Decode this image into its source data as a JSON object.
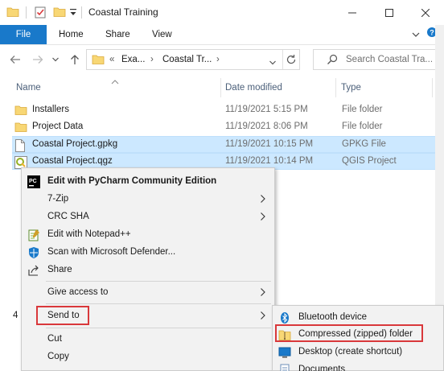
{
  "window": {
    "title": "Coastal Training",
    "controls": [
      "minimize-icon",
      "maximize-icon",
      "close-icon"
    ]
  },
  "ribbon": {
    "tabs": [
      {
        "label": "File",
        "active": true
      },
      {
        "label": "Home"
      },
      {
        "label": "Share"
      },
      {
        "label": "View"
      }
    ]
  },
  "address": {
    "overflow": "«",
    "crumbs": [
      "Exa...",
      "Coastal Tr..."
    ],
    "search_placeholder": "Search Coastal Tra..."
  },
  "columns": {
    "name": "Name",
    "date": "Date modified",
    "type": "Type",
    "size": "S"
  },
  "files": [
    {
      "name": "Installers",
      "date": "11/19/2021 5:15 PM",
      "type": "File folder",
      "icon": "folder-icon",
      "selected": false
    },
    {
      "name": "Project Data",
      "date": "11/19/2021 8:06 PM",
      "type": "File folder",
      "icon": "folder-icon",
      "selected": false
    },
    {
      "name": "Coastal Project.gpkg",
      "date": "11/19/2021 10:15 PM",
      "type": "GPKG File",
      "icon": "document-icon",
      "selected": true
    },
    {
      "name": "Coastal Project.qgz",
      "date": "11/19/2021 10:14 PM",
      "type": "QGIS Project",
      "icon": "qgis-icon",
      "selected": true
    }
  ],
  "status": {
    "item_count": "4"
  },
  "context_menu": {
    "items": [
      {
        "label": "Edit with PyCharm Community Edition",
        "icon": "pycharm-icon",
        "bold": true
      },
      {
        "label": "7-Zip",
        "submenu": true
      },
      {
        "label": "CRC SHA",
        "submenu": true
      },
      {
        "label": "Edit with Notepad++",
        "icon": "notepad-plus-plus-icon"
      },
      {
        "label": "Scan with Microsoft Defender...",
        "icon": "defender-shield-icon"
      },
      {
        "label": "Share",
        "icon": "share-icon"
      },
      {
        "label": "Give access to",
        "submenu": true
      },
      {
        "label": "Send to",
        "submenu": true,
        "highlighted": true
      },
      {
        "label": "Cut"
      },
      {
        "label": "Copy"
      }
    ]
  },
  "send_to_menu": {
    "items": [
      {
        "label": "Bluetooth device",
        "icon": "bluetooth-icon"
      },
      {
        "label": "Compressed (zipped) folder",
        "icon": "zip-folder-icon",
        "highlighted": true
      },
      {
        "label": "Desktop (create shortcut)",
        "icon": "desktop-icon"
      },
      {
        "label": "Documents",
        "icon": "documents-icon"
      }
    ]
  },
  "colors": {
    "accent": "#1979ca",
    "selection": "#cce8ff",
    "highlight_box": "#d9383b",
    "folder": "#f8d775"
  }
}
